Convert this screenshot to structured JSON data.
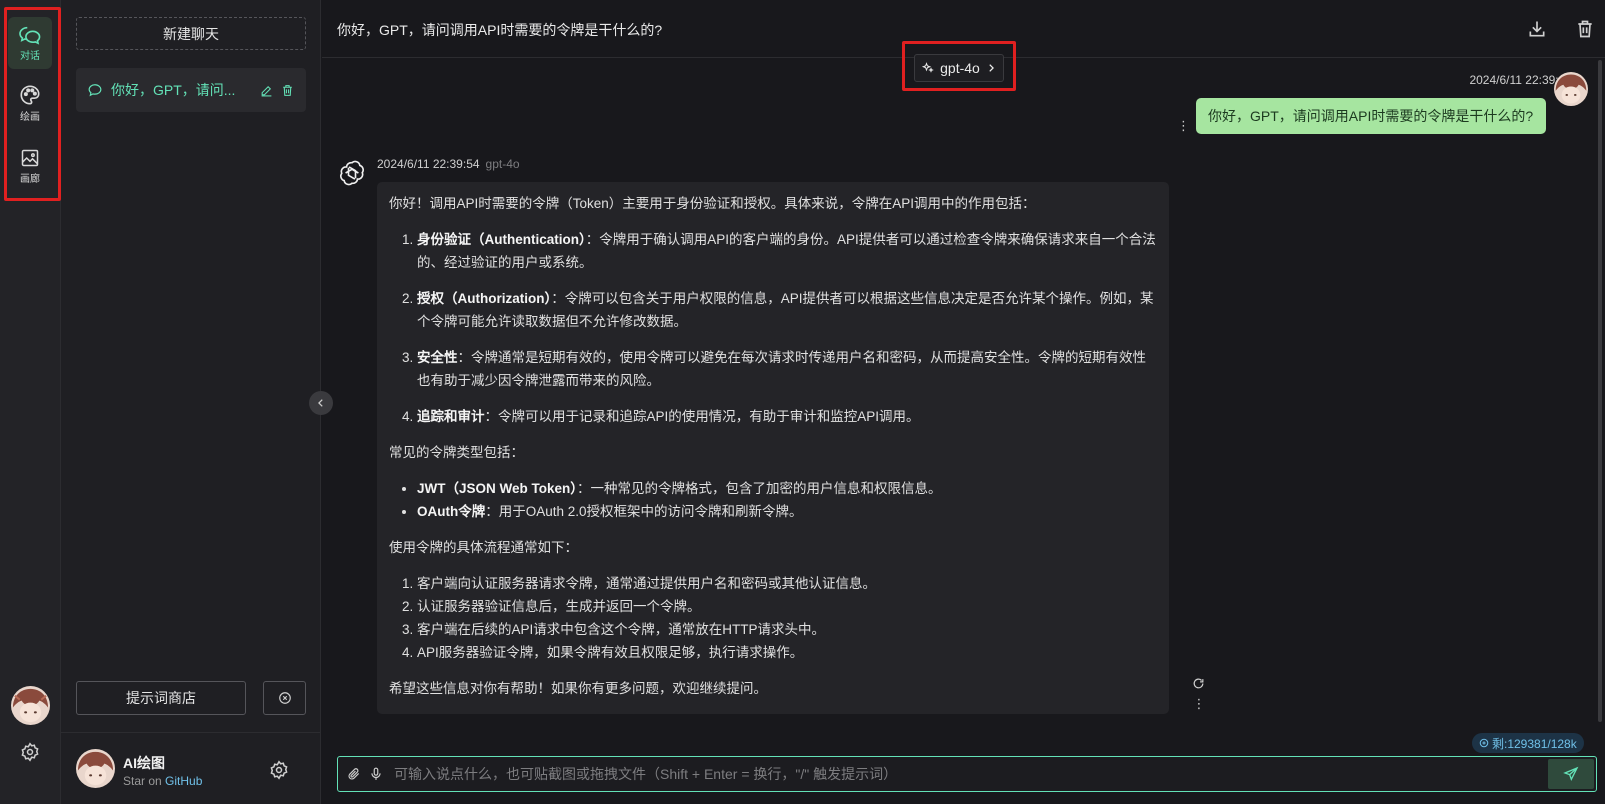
{
  "rail": {
    "items": [
      {
        "label": "对话",
        "icon": "chat-bubbles-icon",
        "active": true
      },
      {
        "label": "绘画",
        "icon": "palette-icon",
        "active": false
      },
      {
        "label": "画廊",
        "icon": "image-icon",
        "active": false
      }
    ],
    "settings_icon": "gear-icon"
  },
  "sidebar": {
    "new_chat_label": "新建聊天",
    "conversations": [
      {
        "title": "你好，GPT，请问..."
      }
    ],
    "prompt_store_label": "提示词商店",
    "footer": {
      "title": "AI绘图",
      "sub_prefix": "Star on ",
      "sub_link": "GitHub"
    }
  },
  "header": {
    "title": "你好，GPT，请问调用API时需要的令牌是干什么的?"
  },
  "model_selector": {
    "label": "gpt-4o"
  },
  "messages": {
    "user": {
      "time": "2024/6/11 22:39:41",
      "text": "你好，GPT，请问调用API时需要的令牌是干什么的?"
    },
    "assistant": {
      "time": "2024/6/11 22:39:54",
      "model": "gpt-4o",
      "intro": "你好！调用API时需要的令牌（Token）主要用于身份验证和授权。具体来说，令牌在API调用中的作用包括：",
      "roles": [
        {
          "term": "身份验证（Authentication）",
          "sep": "：",
          "text": "令牌用于确认调用API的客户端的身份。API提供者可以通过检查令牌来确保请求来自一个合法的、经过验证的用户或系统。"
        },
        {
          "term": "授权（Authorization）",
          "sep": "：",
          "text": "令牌可以包含关于用户权限的信息，API提供者可以根据这些信息决定是否允许某个操作。例如，某个令牌可能允许读取数据但不允许修改数据。"
        },
        {
          "term": "安全性",
          "sep": "：",
          "text": "令牌通常是短期有效的，使用令牌可以避免在每次请求时传递用户名和密码，从而提高安全性。令牌的短期有效性也有助于减少因令牌泄露而带来的风险。"
        },
        {
          "term": "追踪和审计",
          "sep": "：",
          "text": "令牌可以用于记录和追踪API的使用情况，有助于审计和监控API调用。"
        }
      ],
      "types_heading": "常见的令牌类型包括：",
      "types": [
        {
          "term": "JWT（JSON Web Token）",
          "sep": "：",
          "text": "一种常见的令牌格式，包含了加密的用户信息和权限信息。"
        },
        {
          "term": "OAuth令牌",
          "sep": "：",
          "text": "用于OAuth 2.0授权框架中的访问令牌和刷新令牌。"
        }
      ],
      "flow_heading": "使用令牌的具体流程通常如下：",
      "flow": [
        "客户端向认证服务器请求令牌，通常通过提供用户名和密码或其他认证信息。",
        "认证服务器验证信息后，生成并返回一个令牌。",
        "客户端在后续的API请求中包含这个令牌，通常放在HTTP请求头中。",
        "API服务器验证令牌，如果令牌有效且权限足够，执行请求操作。"
      ],
      "closing": "希望这些信息对你有帮助！如果你有更多问题，欢迎继续提问。"
    }
  },
  "token_badge": "剩:129381/128k",
  "input": {
    "placeholder": "可输入说点什么，也可贴截图或拖拽文件（Shift + Enter = 换行，\"/\" 触发提示词）",
    "value": ""
  },
  "colors": {
    "accent": "#63e2b7",
    "user_bubble": "#a6e5a0",
    "highlight_box": "#e02020",
    "link": "#70c0e8"
  }
}
